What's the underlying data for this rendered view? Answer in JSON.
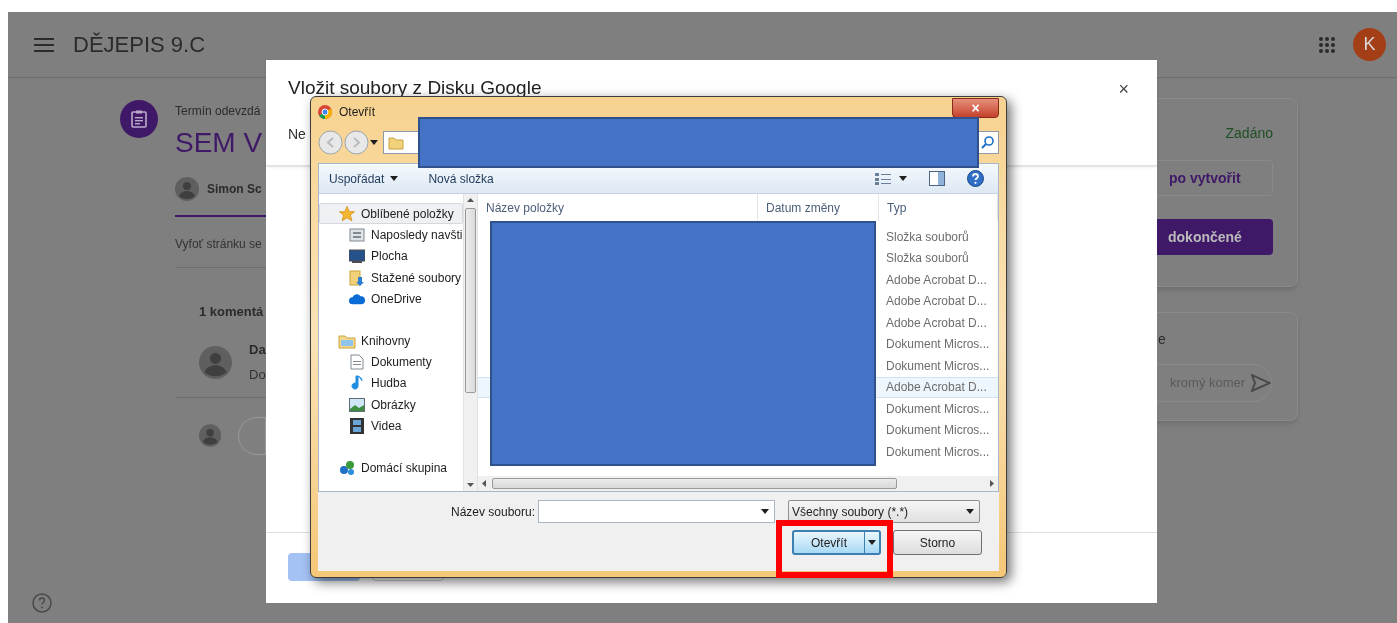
{
  "page": {
    "class_title": "DĚJEPIS 9.C",
    "account_initial": "K",
    "due_label": "Termín odevzdá",
    "assignment_title": "SEM V",
    "author": "Simon Sc",
    "description": "Vyfoť stránku se",
    "comments_heading": "1 komentá",
    "comment_author": "Da",
    "comment_text": "Do",
    "status": "Zadáno",
    "add_button": "po vytvořit",
    "done_button": "dokončené",
    "private_heading": "e",
    "private_placeholder": "kromý komer"
  },
  "drive_dialog": {
    "title": "Vložit soubory z Disku Google",
    "close": "×",
    "tab_fragment": "Ne"
  },
  "open_dialog": {
    "title": "Otevřít",
    "close": "×",
    "toolbar": [
      "Uspořádat",
      "Nová složka"
    ],
    "sidebar": [
      {
        "label": "Oblíbené položky",
        "selected": true,
        "children": [
          {
            "label": "Naposledy navšti",
            "selected": false
          },
          {
            "label": "Plocha",
            "selected": false
          },
          {
            "label": "Stažené soubory",
            "selected": false
          },
          {
            "label": "OneDrive",
            "selected": false
          }
        ]
      },
      {
        "label": "Knihovny",
        "selected": false,
        "children": [
          {
            "label": "Dokumenty",
            "selected": false
          },
          {
            "label": "Hudba",
            "selected": false
          },
          {
            "label": "Obrázky",
            "selected": false
          },
          {
            "label": "Videa",
            "selected": false
          }
        ]
      },
      {
        "label": "Domácí skupina",
        "selected": false
      }
    ],
    "columns": [
      "Název položky",
      "Datum změny",
      "Typ"
    ],
    "rows": [
      {
        "type": "Složka souborů",
        "selected": false
      },
      {
        "type": "Složka souborů",
        "selected": false
      },
      {
        "type": "Adobe Acrobat D...",
        "selected": false
      },
      {
        "type": "Adobe Acrobat D...",
        "selected": false
      },
      {
        "type": "Adobe Acrobat D...",
        "selected": false
      },
      {
        "type": "Dokument Micros...",
        "selected": false
      },
      {
        "type": "Dokument Micros...",
        "selected": false
      },
      {
        "type": "Adobe Acrobat D...",
        "selected": true
      },
      {
        "type": "Dokument Micros...",
        "selected": false
      },
      {
        "type": "Dokument Micros...",
        "selected": false
      },
      {
        "type": "Dokument Micros...",
        "selected": false
      }
    ],
    "filename_label": "Název souboru:",
    "file_type": "Všechny soubory (*.*)",
    "open_button": "Otevřít",
    "cancel_button": "Storno"
  }
}
